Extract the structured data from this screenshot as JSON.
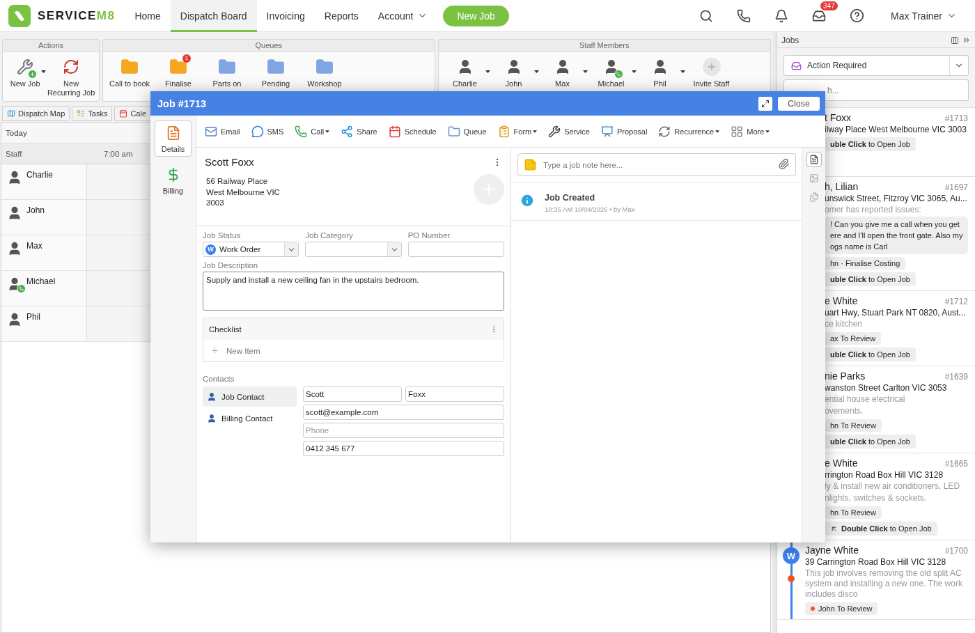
{
  "topbar": {
    "logo": {
      "name": "SERVICE",
      "suffix": "M8"
    },
    "links": [
      {
        "label": "Home",
        "selected": false,
        "dropdown": false
      },
      {
        "label": "Dispatch Board",
        "selected": true,
        "dropdown": false
      },
      {
        "label": "Invoicing",
        "selected": false,
        "dropdown": false
      },
      {
        "label": "Reports",
        "selected": false,
        "dropdown": false
      },
      {
        "label": "Account",
        "selected": false,
        "dropdown": true
      }
    ],
    "new_job": "New Job",
    "inbox_badge": "347",
    "user": "Max Trainer"
  },
  "ribbon": {
    "actions": {
      "title": "Actions",
      "items": [
        {
          "kind": "new-job",
          "label": "New Job",
          "dropdown": true
        },
        {
          "kind": "recurring",
          "label": "New Recurring Job",
          "dropdown": false
        }
      ]
    },
    "queues": {
      "title": "Queues",
      "items": [
        {
          "label": "Call to book",
          "color": "#f5a623"
        },
        {
          "label": "Finalise",
          "color": "#f5a623",
          "badge": "1"
        },
        {
          "label": "Parts on",
          "color": "#7fa6e3"
        },
        {
          "label": "Pending",
          "color": "#7fa6e3"
        },
        {
          "label": "Workshop",
          "color": "#7fa6e3"
        }
      ]
    },
    "staff": {
      "title": "Staff Members",
      "items": [
        {
          "label": "Charlie",
          "on_call": false
        },
        {
          "label": "John",
          "on_call": false
        },
        {
          "label": "Max",
          "on_call": false
        },
        {
          "label": "Michael",
          "on_call": true
        },
        {
          "label": "Phil",
          "on_call": false
        }
      ],
      "invite": "Invite Staff"
    }
  },
  "tabs": [
    {
      "kind": "map",
      "label": "Dispatch Map",
      "selected": false
    },
    {
      "kind": "tasks",
      "label": "Tasks",
      "selected": false
    },
    {
      "kind": "calendar",
      "label": "Cale",
      "selected": false
    }
  ],
  "board": {
    "today": "Today",
    "staff_heading": "Staff",
    "time": "7:00 am",
    "staff": [
      {
        "name": "Charlie",
        "on_call": false
      },
      {
        "name": "John",
        "on_call": false
      },
      {
        "name": "Max",
        "on_call": false
      },
      {
        "name": "Michael",
        "on_call": true
      },
      {
        "name": "Phil",
        "on_call": false
      }
    ]
  },
  "jobs_panel": {
    "title": "Jobs",
    "filter": "Action Required",
    "search_placeholder": "h...",
    "cards": [
      {
        "name": "t Foxx",
        "number": "#1713",
        "address": "ilway Place West Melbourne VIC 3003",
        "open": "**uble Click** to Open Job",
        "alert": false
      },
      {
        "name": "h, Lilian",
        "number": "#1697",
        "address": "unswick Street, Fitzroy VIC 3065, Au...",
        "description": [
          "omer has reported issues:"
        ],
        "message": [
          "! Can you give me a call when you get",
          "ere and I'll open the front gate. Also my",
          "ogs name is Carl"
        ],
        "tag": "hn · Finalise Costing",
        "open": "**uble Click** to Open Job",
        "alert": false
      },
      {
        "name": "e White",
        "number": "#1712",
        "address": "uart Hwy, Stuart Park NT 0820, Aust...",
        "description": [
          "ce kitchen"
        ],
        "tag": "ax To Review",
        "open": "**uble Click** to Open Job",
        "alert": false
      },
      {
        "name": "nie Parks",
        "number": "#1639",
        "address": "wanston Street Carlton VIC 3053",
        "description": [
          "ential house electrical",
          "ovements."
        ],
        "tag": "hn To Review",
        "open": "**uble Click** to Open Job",
        "alert": false
      },
      {
        "name": "e White",
        "number": "#1665",
        "address": "rrington Road Box Hill VIC 3128",
        "description": [
          "ly & install new air conditioners, LED",
          "nlights, switches & sockets."
        ],
        "tag": "hn To Review",
        "open": "**Double Click** to Open Job",
        "open_icon": true,
        "alert": false
      },
      {
        "name": "Jayne White",
        "avatar": "W",
        "number": "#1700",
        "address": "39 Carrington Road Box Hill VIC 3128",
        "description": [
          "This job involves removing the old split AC system and installing a new one. The work includes disco"
        ],
        "tag": "John To Review",
        "alert": true
      }
    ]
  },
  "job_modal": {
    "title": "Job #1713",
    "close": "Close",
    "side_tabs": [
      {
        "kind": "details",
        "label": "Details",
        "selected": true
      },
      {
        "kind": "billing",
        "label": "Billing",
        "selected": false
      }
    ],
    "toolbar": [
      {
        "kind": "email",
        "label": "Email",
        "dropdown": false
      },
      {
        "kind": "sms",
        "label": "SMS",
        "dropdown": false
      },
      {
        "kind": "call",
        "label": "Call",
        "dropdown": true
      },
      {
        "kind": "share",
        "label": "Share",
        "dropdown": false
      },
      {
        "kind": "schedule",
        "label": "Schedule",
        "dropdown": false
      },
      {
        "kind": "queue",
        "label": "Queue",
        "dropdown": false
      },
      {
        "kind": "form",
        "label": "Form",
        "dropdown": true
      },
      {
        "kind": "service",
        "label": "Service",
        "dropdown": false
      },
      {
        "kind": "proposal",
        "label": "Proposal",
        "dropdown": false
      },
      {
        "kind": "recurrence",
        "label": "Recurrence",
        "dropdown": true
      },
      {
        "kind": "more",
        "label": "More",
        "dropdown": true
      }
    ],
    "client": {
      "name": "Scott Foxx",
      "address": [
        "56 Railway Place",
        "West Melbourne VIC",
        "3003"
      ]
    },
    "job_status": {
      "label": "Job Status",
      "value": "Work Order",
      "badge": "W"
    },
    "job_category": {
      "label": "Job Category"
    },
    "po_number": {
      "label": "PO Number"
    },
    "description": {
      "label": "Job Description",
      "value": "Supply and install a new ceiling fan in the upstairs bedroom."
    },
    "checklist": {
      "title": "Checklist",
      "new_item": "New Item"
    },
    "contacts": {
      "heading": "Contacts",
      "tabs": [
        {
          "label": "Job Contact",
          "selected": true
        },
        {
          "label": "Billing Contact",
          "selected": false
        }
      ],
      "first_name": "Scott",
      "last_name": "Foxx",
      "email": "scott@example.com",
      "phone_placeholder": "Phone",
      "mobile": "0412 345 677"
    },
    "note_placeholder": "Type a job note here...",
    "notes": [
      {
        "title": "Job Created",
        "meta": "10:35 AM 10/04/2026 •  by Max"
      }
    ],
    "note_views": [
      {
        "kind": "notes",
        "selected": true
      },
      {
        "kind": "photos",
        "selected": false
      },
      {
        "kind": "files",
        "selected": false
      }
    ]
  }
}
